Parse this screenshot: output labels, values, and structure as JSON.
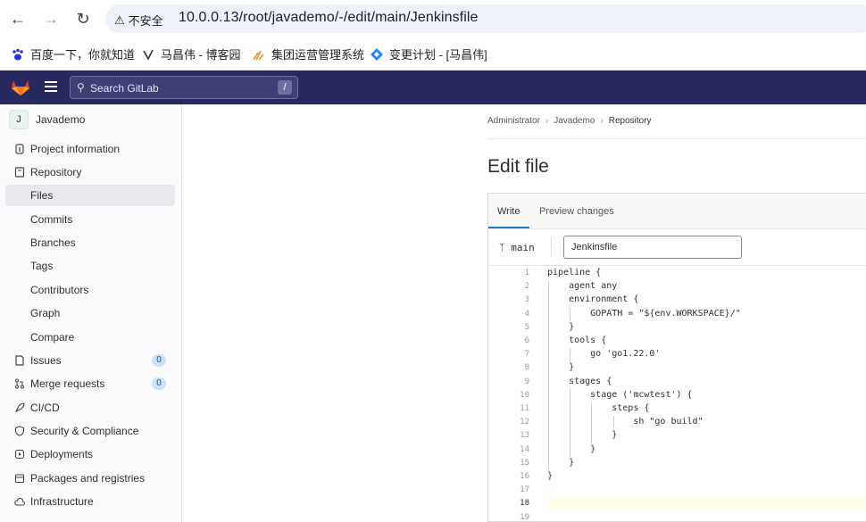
{
  "browser": {
    "insecure_label": "不安全",
    "url": "10.0.0.13/root/javademo/-/edit/main/Jenkinsfile",
    "bookmarks": [
      {
        "label": "百度一下，你就知道",
        "icon": "baidu-paw-icon"
      },
      {
        "label": "马昌伟 - 博客园",
        "icon": "cnblogs-icon"
      },
      {
        "label": "集团运营管理系统",
        "icon": "spark-icon"
      },
      {
        "label": "变更计划 - [马昌伟]",
        "icon": "jira-icon"
      }
    ]
  },
  "header": {
    "search_placeholder": "Search GitLab",
    "search_shortcut": "/"
  },
  "sidebar": {
    "project_initial": "J",
    "project_name": "Javademo",
    "items": [
      {
        "label": "Project information",
        "icon": "info-icon"
      },
      {
        "label": "Repository",
        "icon": "book-icon"
      },
      {
        "label": "Files",
        "active": true
      },
      {
        "label": "Commits"
      },
      {
        "label": "Branches"
      },
      {
        "label": "Tags"
      },
      {
        "label": "Contributors"
      },
      {
        "label": "Graph"
      },
      {
        "label": "Compare"
      },
      {
        "label": "Issues",
        "icon": "issues-icon",
        "badge": "0"
      },
      {
        "label": "Merge requests",
        "icon": "merge-request-icon",
        "badge": "0"
      },
      {
        "label": "CI/CD",
        "icon": "rocket-icon"
      },
      {
        "label": "Security & Compliance",
        "icon": "shield-icon"
      },
      {
        "label": "Deployments",
        "icon": "deploy-icon"
      },
      {
        "label": "Packages and registries",
        "icon": "package-icon"
      },
      {
        "label": "Infrastructure",
        "icon": "cloud-icon"
      }
    ]
  },
  "breadcrumb": [
    "Administrator",
    "Javademo",
    "Repository"
  ],
  "page_title": "Edit file",
  "editor": {
    "tabs": [
      "Write",
      "Preview changes"
    ],
    "branch": "main",
    "filename": "Jenkinsfile",
    "lines": [
      "pipeline {",
      "    agent any",
      "    environment {",
      "        GOPATH = \"${env.WORKSPACE}/\"",
      "    }",
      "    tools {",
      "        go 'go1.22.0'",
      "    }",
      "    stages {",
      "        stage ('mcwtest') {",
      "            steps {",
      "                sh \"go build\"",
      "            }",
      "        }",
      "    }",
      "}",
      "",
      "",
      ""
    ],
    "line_numbers": [
      "1",
      "2",
      "3",
      "4",
      "5",
      "6",
      "7",
      "8",
      "9",
      "10",
      "11",
      "12",
      "13",
      "14",
      "15",
      "16",
      "17",
      "18",
      "19"
    ],
    "current_line": 18
  }
}
